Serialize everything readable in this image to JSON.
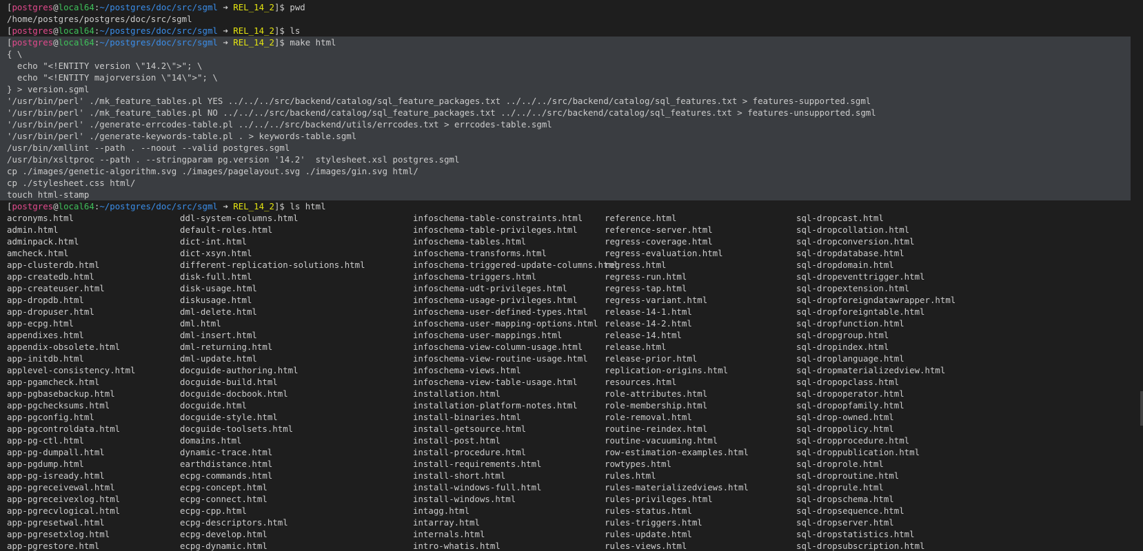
{
  "prompt": {
    "open_bracket": "[",
    "user": "postgres",
    "at": "@",
    "host": "local64",
    "colon": ":",
    "path": "~/postgres/doc/src/sgml",
    "arrow": " ➜ ",
    "branch": "REL_14_2",
    "close": "]$ "
  },
  "session": [
    {
      "type": "prompt",
      "command": "pwd",
      "selected": false
    },
    {
      "type": "output",
      "text": "/home/postgres/postgres/doc/src/sgml",
      "selected": false
    },
    {
      "type": "prompt",
      "command": "ls",
      "selected": false
    },
    {
      "type": "prompt",
      "command": "make html",
      "selected": true
    },
    {
      "type": "output",
      "text": "{ \\",
      "selected": true
    },
    {
      "type": "output",
      "text": "  echo \"<!ENTITY version \\\"14.2\\\">\"; \\",
      "selected": true
    },
    {
      "type": "output",
      "text": "  echo \"<!ENTITY majorversion \\\"14\\\">\"; \\",
      "selected": true
    },
    {
      "type": "output",
      "text": "} > version.sgml",
      "selected": true
    },
    {
      "type": "output",
      "text": "'/usr/bin/perl' ./mk_feature_tables.pl YES ../../../src/backend/catalog/sql_feature_packages.txt ../../../src/backend/catalog/sql_features.txt > features-supported.sgml",
      "selected": true
    },
    {
      "type": "output",
      "text": "'/usr/bin/perl' ./mk_feature_tables.pl NO ../../../src/backend/catalog/sql_feature_packages.txt ../../../src/backend/catalog/sql_features.txt > features-unsupported.sgml",
      "selected": true
    },
    {
      "type": "output",
      "text": "'/usr/bin/perl' ./generate-errcodes-table.pl ../../../src/backend/utils/errcodes.txt > errcodes-table.sgml",
      "selected": true
    },
    {
      "type": "output",
      "text": "'/usr/bin/perl' ./generate-keywords-table.pl . > keywords-table.sgml",
      "selected": true
    },
    {
      "type": "output",
      "text": "/usr/bin/xmllint --path . --noout --valid postgres.sgml",
      "selected": true
    },
    {
      "type": "output",
      "text": "/usr/bin/xsltproc --path . --stringparam pg.version '14.2'  stylesheet.xsl postgres.sgml",
      "selected": true
    },
    {
      "type": "output",
      "text": "cp ./images/genetic-algorithm.svg ./images/pagelayout.svg ./images/gin.svg html/",
      "selected": true
    },
    {
      "type": "output",
      "text": "cp ./stylesheet.css html/",
      "selected": true
    },
    {
      "type": "output",
      "text": "touch html-stamp",
      "selected": true
    },
    {
      "type": "prompt",
      "command": "ls html",
      "selected": false
    }
  ],
  "listing": [
    [
      "acronyms.html",
      "admin.html",
      "adminpack.html",
      "amcheck.html",
      "app-clusterdb.html",
      "app-createdb.html",
      "app-createuser.html",
      "app-dropdb.html",
      "app-dropuser.html",
      "app-ecpg.html",
      "appendixes.html",
      "appendix-obsolete.html",
      "app-initdb.html",
      "applevel-consistency.html",
      "app-pgamcheck.html",
      "app-pgbasebackup.html",
      "app-pgchecksums.html",
      "app-pgconfig.html",
      "app-pgcontroldata.html",
      "app-pg-ctl.html",
      "app-pg-dumpall.html",
      "app-pgdump.html",
      "app-pg-isready.html",
      "app-pgreceivewal.html",
      "app-pgreceivexlog.html",
      "app-pgrecvlogical.html",
      "app-pgresetwal.html",
      "app-pgresetxlog.html",
      "app-pgrestore.html"
    ],
    [
      "ddl-system-columns.html",
      "default-roles.html",
      "dict-int.html",
      "dict-xsyn.html",
      "different-replication-solutions.html",
      "disk-full.html",
      "disk-usage.html",
      "diskusage.html",
      "dml-delete.html",
      "dml.html",
      "dml-insert.html",
      "dml-returning.html",
      "dml-update.html",
      "docguide-authoring.html",
      "docguide-build.html",
      "docguide-docbook.html",
      "docguide.html",
      "docguide-style.html",
      "docguide-toolsets.html",
      "domains.html",
      "dynamic-trace.html",
      "earthdistance.html",
      "ecpg-commands.html",
      "ecpg-concept.html",
      "ecpg-connect.html",
      "ecpg-cpp.html",
      "ecpg-descriptors.html",
      "ecpg-develop.html",
      "ecpg-dynamic.html"
    ],
    [
      "infoschema-table-constraints.html",
      "infoschema-table-privileges.html",
      "infoschema-tables.html",
      "infoschema-transforms.html",
      "infoschema-triggered-update-columns.html",
      "infoschema-triggers.html",
      "infoschema-udt-privileges.html",
      "infoschema-usage-privileges.html",
      "infoschema-user-defined-types.html",
      "infoschema-user-mapping-options.html",
      "infoschema-user-mappings.html",
      "infoschema-view-column-usage.html",
      "infoschema-view-routine-usage.html",
      "infoschema-views.html",
      "infoschema-view-table-usage.html",
      "installation.html",
      "installation-platform-notes.html",
      "install-binaries.html",
      "install-getsource.html",
      "install-post.html",
      "install-procedure.html",
      "install-requirements.html",
      "install-short.html",
      "install-windows-full.html",
      "install-windows.html",
      "intagg.html",
      "intarray.html",
      "internals.html",
      "intro-whatis.html"
    ],
    [
      "reference.html",
      "reference-server.html",
      "regress-coverage.html",
      "regress-evaluation.html",
      "regress.html",
      "regress-run.html",
      "regress-tap.html",
      "regress-variant.html",
      "release-14-1.html",
      "release-14-2.html",
      "release-14.html",
      "release.html",
      "release-prior.html",
      "replication-origins.html",
      "resources.html",
      "role-attributes.html",
      "role-membership.html",
      "role-removal.html",
      "routine-reindex.html",
      "routine-vacuuming.html",
      "row-estimation-examples.html",
      "rowtypes.html",
      "rules.html",
      "rules-materializedviews.html",
      "rules-privileges.html",
      "rules-status.html",
      "rules-triggers.html",
      "rules-update.html",
      "rules-views.html"
    ],
    [
      "sql-dropcast.html",
      "sql-dropcollation.html",
      "sql-dropconversion.html",
      "sql-dropdatabase.html",
      "sql-dropdomain.html",
      "sql-dropeventtrigger.html",
      "sql-dropextension.html",
      "sql-dropforeigndatawrapper.html",
      "sql-dropforeigntable.html",
      "sql-dropfunction.html",
      "sql-dropgroup.html",
      "sql-dropindex.html",
      "sql-droplanguage.html",
      "sql-dropmaterializedview.html",
      "sql-dropopclass.html",
      "sql-dropoperator.html",
      "sql-dropopfamily.html",
      "sql-drop-owned.html",
      "sql-droppolicy.html",
      "sql-dropprocedure.html",
      "sql-droppublication.html",
      "sql-droprole.html",
      "sql-droproutine.html",
      "sql-droprule.html",
      "sql-dropschema.html",
      "sql-dropsequence.html",
      "sql-dropserver.html",
      "sql-dropstatistics.html",
      "sql-dropsubscription.html"
    ]
  ]
}
